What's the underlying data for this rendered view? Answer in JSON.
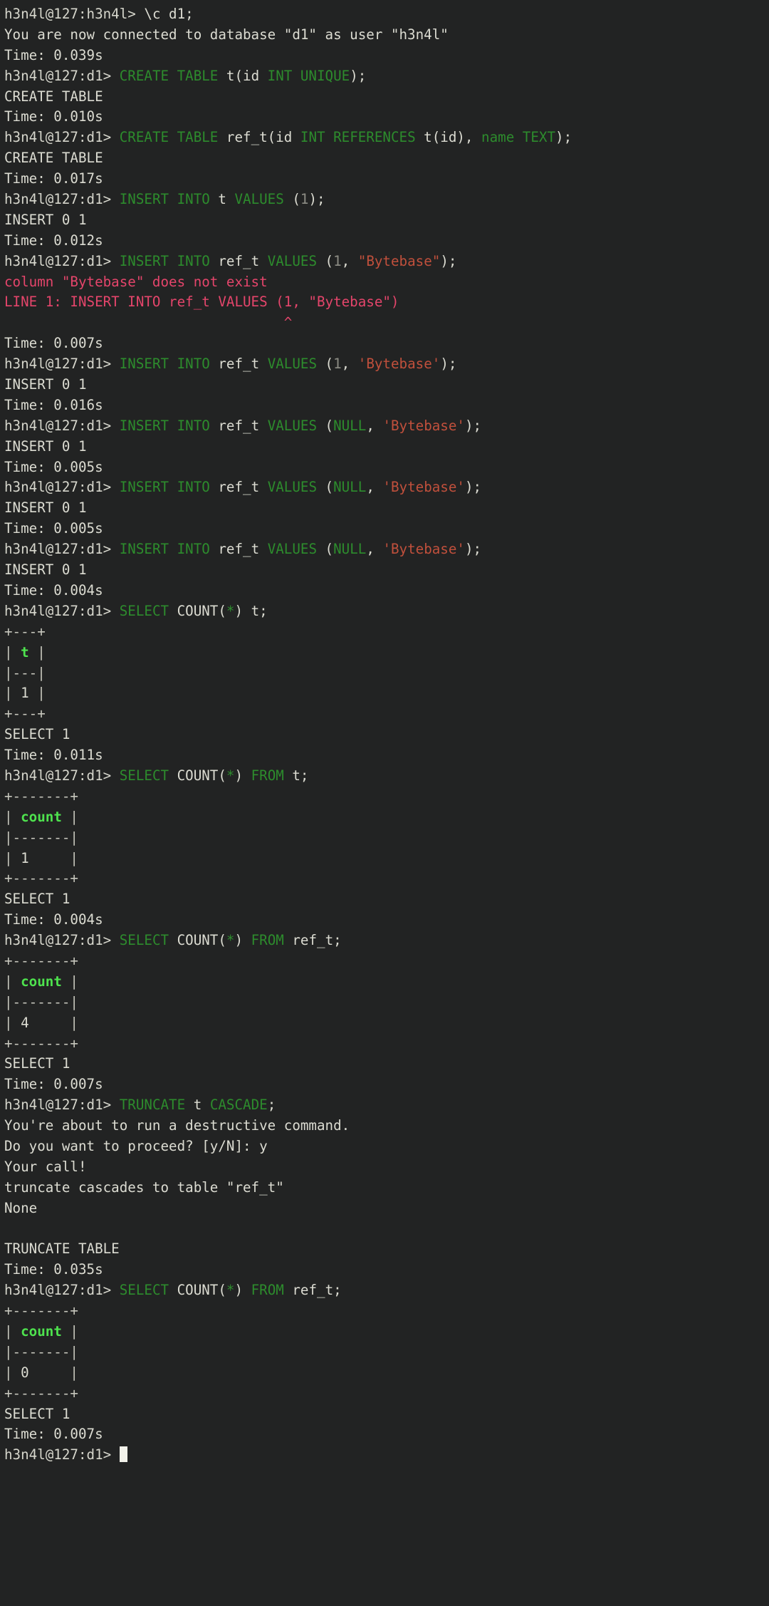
{
  "terminal": {
    "title": "usql SQL shell session",
    "background_color": "#222323",
    "foreground_color": "#dcdcd2",
    "keyword_color": "#2d8c2d",
    "header_color": "#4ee24e",
    "error_color": "#e5456b",
    "string_color": "#c1503c",
    "number_color": "#8d8d85",
    "cursor_color": "#f2f2ea",
    "prompt_root": "h3n4l@127:h3n4l>",
    "prompt_db": "h3n4l@127:d1>",
    "cursor_char": "block-cursor"
  },
  "lines": [
    {
      "id": 1,
      "segs": [
        {
          "t": "h3n4l@127:h3n4l> ",
          "c": "prompt"
        },
        {
          "t": "\\c d1;",
          "c": "plain"
        }
      ]
    },
    {
      "id": 2,
      "segs": [
        {
          "t": "You are now connected to database \"d1\" as user \"h3n4l\"",
          "c": "plain"
        }
      ]
    },
    {
      "id": 3,
      "segs": [
        {
          "t": "Time: 0.039s",
          "c": "plain"
        }
      ]
    },
    {
      "id": 4,
      "segs": [
        {
          "t": "h3n4l@127:d1> ",
          "c": "prompt"
        },
        {
          "t": "CREATE TABLE",
          "c": "kw"
        },
        {
          "t": " t(id ",
          "c": "plain"
        },
        {
          "t": "INT UNIQUE",
          "c": "kw"
        },
        {
          "t": ");",
          "c": "plain"
        }
      ]
    },
    {
      "id": 5,
      "segs": [
        {
          "t": "CREATE TABLE",
          "c": "plain"
        }
      ]
    },
    {
      "id": 6,
      "segs": [
        {
          "t": "Time: 0.010s",
          "c": "plain"
        }
      ]
    },
    {
      "id": 7,
      "segs": [
        {
          "t": "h3n4l@127:d1> ",
          "c": "prompt"
        },
        {
          "t": "CREATE TABLE",
          "c": "kw"
        },
        {
          "t": " ref_t(id ",
          "c": "plain"
        },
        {
          "t": "INT REFERENCES",
          "c": "kw"
        },
        {
          "t": " t(id), ",
          "c": "plain"
        },
        {
          "t": "name TEXT",
          "c": "kw"
        },
        {
          "t": ");",
          "c": "plain"
        }
      ]
    },
    {
      "id": 8,
      "segs": [
        {
          "t": "CREATE TABLE",
          "c": "plain"
        }
      ]
    },
    {
      "id": 9,
      "segs": [
        {
          "t": "Time: 0.017s",
          "c": "plain"
        }
      ]
    },
    {
      "id": 10,
      "segs": [
        {
          "t": "h3n4l@127:d1> ",
          "c": "prompt"
        },
        {
          "t": "INSERT INTO",
          "c": "kw"
        },
        {
          "t": " t ",
          "c": "plain"
        },
        {
          "t": "VALUES",
          "c": "kw"
        },
        {
          "t": " (",
          "c": "plain"
        },
        {
          "t": "1",
          "c": "num"
        },
        {
          "t": ");",
          "c": "plain"
        }
      ]
    },
    {
      "id": 11,
      "segs": [
        {
          "t": "INSERT 0 1",
          "c": "plain"
        }
      ]
    },
    {
      "id": 12,
      "segs": [
        {
          "t": "Time: 0.012s",
          "c": "plain"
        }
      ]
    },
    {
      "id": 13,
      "segs": [
        {
          "t": "h3n4l@127:d1> ",
          "c": "prompt"
        },
        {
          "t": "INSERT INTO",
          "c": "kw"
        },
        {
          "t": " ref_t ",
          "c": "plain"
        },
        {
          "t": "VALUES",
          "c": "kw"
        },
        {
          "t": " (",
          "c": "plain"
        },
        {
          "t": "1",
          "c": "num"
        },
        {
          "t": ", ",
          "c": "plain"
        },
        {
          "t": "\"Bytebase\"",
          "c": "str"
        },
        {
          "t": ");",
          "c": "plain"
        }
      ]
    },
    {
      "id": 14,
      "segs": [
        {
          "t": "column \"Bytebase\" does not exist",
          "c": "err"
        }
      ]
    },
    {
      "id": 15,
      "segs": [
        {
          "t": "LINE 1: INSERT INTO ref_t VALUES (1, \"Bytebase\")",
          "c": "err"
        }
      ]
    },
    {
      "id": 16,
      "segs": [
        {
          "t": "                                  ^",
          "c": "err"
        }
      ]
    },
    {
      "id": 17,
      "segs": [
        {
          "t": "Time: 0.007s",
          "c": "plain"
        }
      ]
    },
    {
      "id": 18,
      "segs": [
        {
          "t": "h3n4l@127:d1> ",
          "c": "prompt"
        },
        {
          "t": "INSERT INTO",
          "c": "kw"
        },
        {
          "t": " ref_t ",
          "c": "plain"
        },
        {
          "t": "VALUES",
          "c": "kw"
        },
        {
          "t": " (",
          "c": "plain"
        },
        {
          "t": "1",
          "c": "num"
        },
        {
          "t": ", ",
          "c": "plain"
        },
        {
          "t": "'Bytebase'",
          "c": "str"
        },
        {
          "t": ");",
          "c": "plain"
        }
      ]
    },
    {
      "id": 19,
      "segs": [
        {
          "t": "INSERT 0 1",
          "c": "plain"
        }
      ]
    },
    {
      "id": 20,
      "segs": [
        {
          "t": "Time: 0.016s",
          "c": "plain"
        }
      ]
    },
    {
      "id": 21,
      "segs": [
        {
          "t": "h3n4l@127:d1> ",
          "c": "prompt"
        },
        {
          "t": "INSERT INTO",
          "c": "kw"
        },
        {
          "t": " ref_t ",
          "c": "plain"
        },
        {
          "t": "VALUES",
          "c": "kw"
        },
        {
          "t": " (",
          "c": "plain"
        },
        {
          "t": "NULL",
          "c": "kw"
        },
        {
          "t": ", ",
          "c": "plain"
        },
        {
          "t": "'Bytebase'",
          "c": "str"
        },
        {
          "t": ");",
          "c": "plain"
        }
      ]
    },
    {
      "id": 22,
      "segs": [
        {
          "t": "INSERT 0 1",
          "c": "plain"
        }
      ]
    },
    {
      "id": 23,
      "segs": [
        {
          "t": "Time: 0.005s",
          "c": "plain"
        }
      ]
    },
    {
      "id": 24,
      "segs": [
        {
          "t": "h3n4l@127:d1> ",
          "c": "prompt"
        },
        {
          "t": "INSERT INTO",
          "c": "kw"
        },
        {
          "t": " ref_t ",
          "c": "plain"
        },
        {
          "t": "VALUES",
          "c": "kw"
        },
        {
          "t": " (",
          "c": "plain"
        },
        {
          "t": "NULL",
          "c": "kw"
        },
        {
          "t": ", ",
          "c": "plain"
        },
        {
          "t": "'Bytebase'",
          "c": "str"
        },
        {
          "t": ");",
          "c": "plain"
        }
      ]
    },
    {
      "id": 25,
      "segs": [
        {
          "t": "INSERT 0 1",
          "c": "plain"
        }
      ]
    },
    {
      "id": 26,
      "segs": [
        {
          "t": "Time: 0.005s",
          "c": "plain"
        }
      ]
    },
    {
      "id": 27,
      "segs": [
        {
          "t": "h3n4l@127:d1> ",
          "c": "prompt"
        },
        {
          "t": "INSERT INTO",
          "c": "kw"
        },
        {
          "t": " ref_t ",
          "c": "plain"
        },
        {
          "t": "VALUES",
          "c": "kw"
        },
        {
          "t": " (",
          "c": "plain"
        },
        {
          "t": "NULL",
          "c": "kw"
        },
        {
          "t": ", ",
          "c": "plain"
        },
        {
          "t": "'Bytebase'",
          "c": "str"
        },
        {
          "t": ");",
          "c": "plain"
        }
      ]
    },
    {
      "id": 28,
      "segs": [
        {
          "t": "INSERT 0 1",
          "c": "plain"
        }
      ]
    },
    {
      "id": 29,
      "segs": [
        {
          "t": "Time: 0.004s",
          "c": "plain"
        }
      ]
    },
    {
      "id": 30,
      "segs": [
        {
          "t": "h3n4l@127:d1> ",
          "c": "prompt"
        },
        {
          "t": "SELECT",
          "c": "kw"
        },
        {
          "t": " COUNT(",
          "c": "plain"
        },
        {
          "t": "*",
          "c": "kw"
        },
        {
          "t": ") t;",
          "c": "plain"
        }
      ]
    },
    {
      "id": 31,
      "segs": [
        {
          "t": "+---+",
          "c": "rule"
        }
      ]
    },
    {
      "id": 32,
      "segs": [
        {
          "t": "| ",
          "c": "rule"
        },
        {
          "t": "t",
          "c": "hdr"
        },
        {
          "t": " |",
          "c": "rule"
        }
      ]
    },
    {
      "id": 33,
      "segs": [
        {
          "t": "|---|",
          "c": "rule"
        }
      ]
    },
    {
      "id": 34,
      "segs": [
        {
          "t": "| ",
          "c": "rule"
        },
        {
          "t": "1",
          "c": "plain"
        },
        {
          "t": " |",
          "c": "rule"
        }
      ]
    },
    {
      "id": 35,
      "segs": [
        {
          "t": "+---+",
          "c": "rule"
        }
      ]
    },
    {
      "id": 36,
      "segs": [
        {
          "t": "SELECT 1",
          "c": "plain"
        }
      ]
    },
    {
      "id": 37,
      "segs": [
        {
          "t": "Time: 0.011s",
          "c": "plain"
        }
      ]
    },
    {
      "id": 38,
      "segs": [
        {
          "t": "h3n4l@127:d1> ",
          "c": "prompt"
        },
        {
          "t": "SELECT",
          "c": "kw"
        },
        {
          "t": " COUNT(",
          "c": "plain"
        },
        {
          "t": "*",
          "c": "kw"
        },
        {
          "t": ") ",
          "c": "plain"
        },
        {
          "t": "FROM",
          "c": "kw"
        },
        {
          "t": " t;",
          "c": "plain"
        }
      ]
    },
    {
      "id": 39,
      "segs": [
        {
          "t": "+-------+",
          "c": "rule"
        }
      ]
    },
    {
      "id": 40,
      "segs": [
        {
          "t": "| ",
          "c": "rule"
        },
        {
          "t": "count",
          "c": "hdr"
        },
        {
          "t": " |",
          "c": "rule"
        }
      ]
    },
    {
      "id": 41,
      "segs": [
        {
          "t": "|-------|",
          "c": "rule"
        }
      ]
    },
    {
      "id": 42,
      "segs": [
        {
          "t": "| ",
          "c": "rule"
        },
        {
          "t": "1",
          "c": "plain"
        },
        {
          "t": "     |",
          "c": "rule"
        }
      ]
    },
    {
      "id": 43,
      "segs": [
        {
          "t": "+-------+",
          "c": "rule"
        }
      ]
    },
    {
      "id": 44,
      "segs": [
        {
          "t": "SELECT 1",
          "c": "plain"
        }
      ]
    },
    {
      "id": 45,
      "segs": [
        {
          "t": "Time: 0.004s",
          "c": "plain"
        }
      ]
    },
    {
      "id": 46,
      "segs": [
        {
          "t": "h3n4l@127:d1> ",
          "c": "prompt"
        },
        {
          "t": "SELECT",
          "c": "kw"
        },
        {
          "t": " COUNT(",
          "c": "plain"
        },
        {
          "t": "*",
          "c": "kw"
        },
        {
          "t": ") ",
          "c": "plain"
        },
        {
          "t": "FROM",
          "c": "kw"
        },
        {
          "t": " ref_t;",
          "c": "plain"
        }
      ]
    },
    {
      "id": 47,
      "segs": [
        {
          "t": "+-------+",
          "c": "rule"
        }
      ]
    },
    {
      "id": 48,
      "segs": [
        {
          "t": "| ",
          "c": "rule"
        },
        {
          "t": "count",
          "c": "hdr"
        },
        {
          "t": " |",
          "c": "rule"
        }
      ]
    },
    {
      "id": 49,
      "segs": [
        {
          "t": "|-------|",
          "c": "rule"
        }
      ]
    },
    {
      "id": 50,
      "segs": [
        {
          "t": "| ",
          "c": "rule"
        },
        {
          "t": "4",
          "c": "plain"
        },
        {
          "t": "     |",
          "c": "rule"
        }
      ]
    },
    {
      "id": 51,
      "segs": [
        {
          "t": "+-------+",
          "c": "rule"
        }
      ]
    },
    {
      "id": 52,
      "segs": [
        {
          "t": "SELECT 1",
          "c": "plain"
        }
      ]
    },
    {
      "id": 53,
      "segs": [
        {
          "t": "Time: 0.007s",
          "c": "plain"
        }
      ]
    },
    {
      "id": 54,
      "segs": [
        {
          "t": "h3n4l@127:d1> ",
          "c": "prompt"
        },
        {
          "t": "TRUNCATE",
          "c": "kw"
        },
        {
          "t": " t ",
          "c": "plain"
        },
        {
          "t": "CASCADE",
          "c": "kw"
        },
        {
          "t": ";",
          "c": "plain"
        }
      ]
    },
    {
      "id": 55,
      "segs": [
        {
          "t": "You're about to run a destructive command.",
          "c": "plain"
        }
      ]
    },
    {
      "id": 56,
      "segs": [
        {
          "t": "Do you want to proceed? [y/N]: y",
          "c": "plain"
        }
      ]
    },
    {
      "id": 57,
      "segs": [
        {
          "t": "Your call!",
          "c": "plain"
        }
      ]
    },
    {
      "id": 58,
      "segs": [
        {
          "t": "truncate cascades to table \"ref_t\"",
          "c": "plain"
        }
      ]
    },
    {
      "id": 59,
      "segs": [
        {
          "t": "None",
          "c": "plain"
        }
      ]
    },
    {
      "id": 60,
      "segs": [
        {
          "t": "",
          "c": "plain"
        }
      ]
    },
    {
      "id": 61,
      "segs": [
        {
          "t": "TRUNCATE TABLE",
          "c": "plain"
        }
      ]
    },
    {
      "id": 62,
      "segs": [
        {
          "t": "Time: 0.035s",
          "c": "plain"
        }
      ]
    },
    {
      "id": 63,
      "segs": [
        {
          "t": "h3n4l@127:d1> ",
          "c": "prompt"
        },
        {
          "t": "SELECT",
          "c": "kw"
        },
        {
          "t": " COUNT(",
          "c": "plain"
        },
        {
          "t": "*",
          "c": "kw"
        },
        {
          "t": ") ",
          "c": "plain"
        },
        {
          "t": "FROM",
          "c": "kw"
        },
        {
          "t": " ref_t;",
          "c": "plain"
        }
      ]
    },
    {
      "id": 64,
      "segs": [
        {
          "t": "+-------+",
          "c": "rule"
        }
      ]
    },
    {
      "id": 65,
      "segs": [
        {
          "t": "| ",
          "c": "rule"
        },
        {
          "t": "count",
          "c": "hdr"
        },
        {
          "t": " |",
          "c": "rule"
        }
      ]
    },
    {
      "id": 66,
      "segs": [
        {
          "t": "|-------|",
          "c": "rule"
        }
      ]
    },
    {
      "id": 67,
      "segs": [
        {
          "t": "| ",
          "c": "rule"
        },
        {
          "t": "0",
          "c": "plain"
        },
        {
          "t": "     |",
          "c": "rule"
        }
      ]
    },
    {
      "id": 68,
      "segs": [
        {
          "t": "+-------+",
          "c": "rule"
        }
      ]
    },
    {
      "id": 69,
      "segs": [
        {
          "t": "SELECT 1",
          "c": "plain"
        }
      ]
    },
    {
      "id": 70,
      "segs": [
        {
          "t": "Time: 0.007s",
          "c": "plain"
        }
      ]
    },
    {
      "id": 71,
      "cursor": true,
      "segs": [
        {
          "t": "h3n4l@127:d1> ",
          "c": "prompt"
        }
      ]
    }
  ]
}
